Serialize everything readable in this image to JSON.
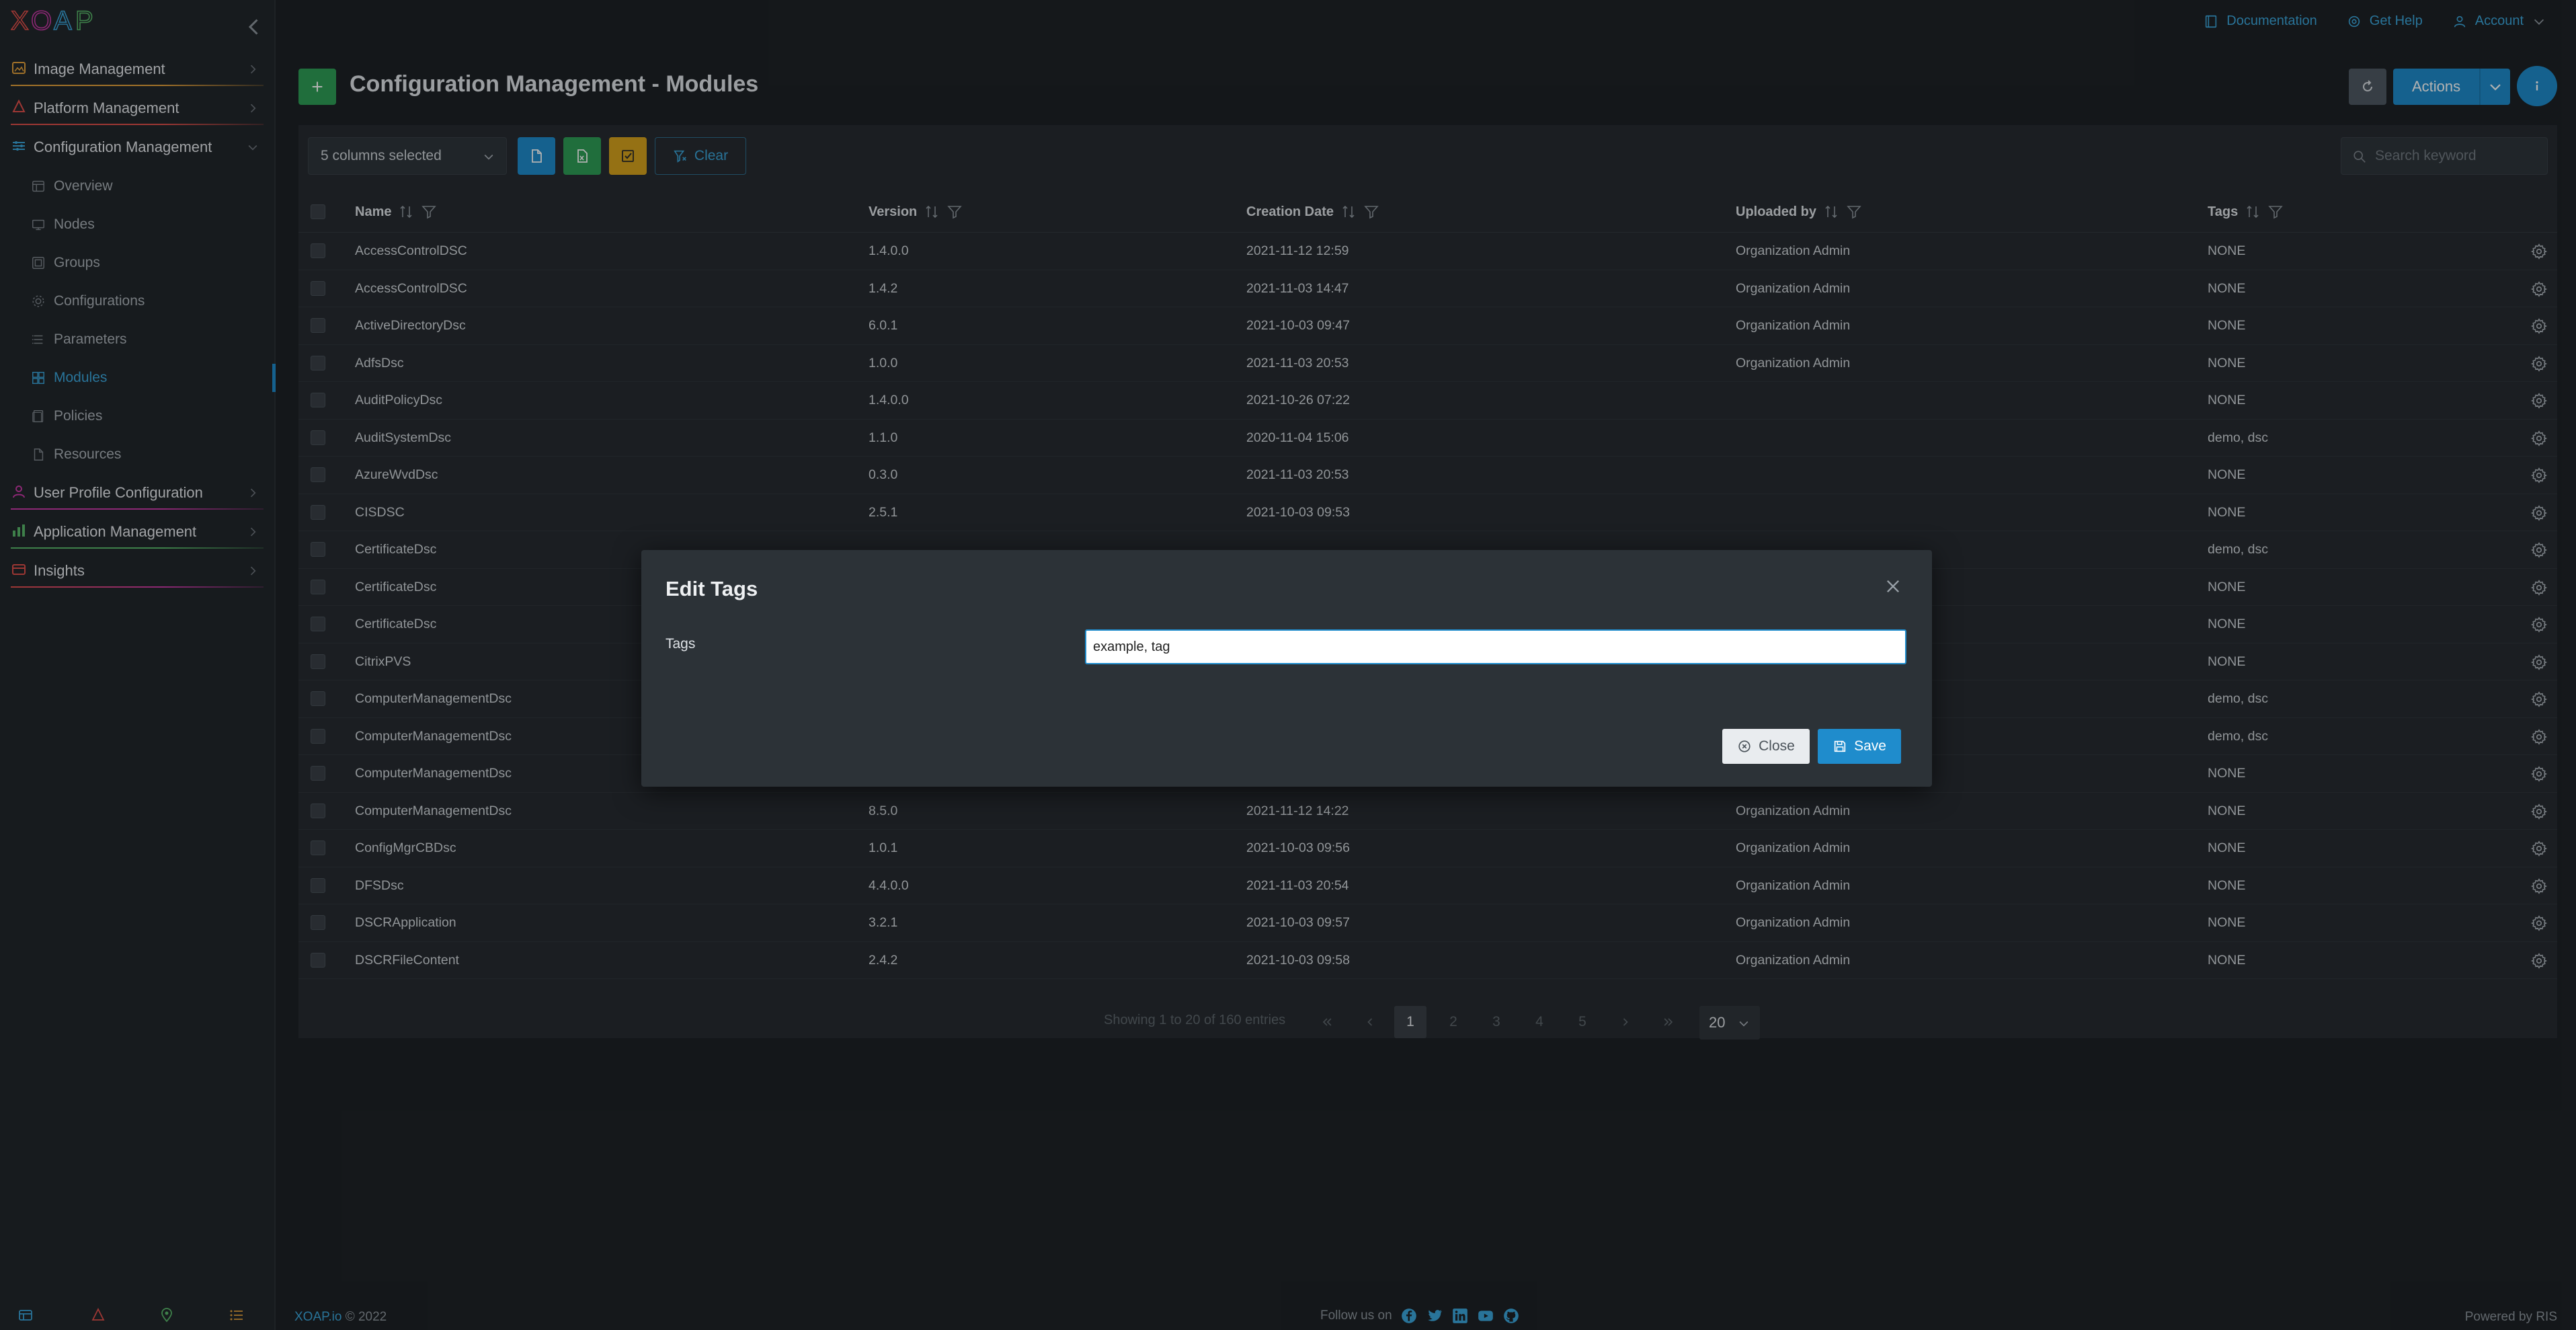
{
  "app": {
    "logo_text": "XOAP"
  },
  "colors": {
    "accent": "#1f8ccc",
    "add": "#2f9e57",
    "sidebar_bg": "#22272b",
    "panel_bg": "#272c31"
  },
  "sidebar": {
    "groups": [
      {
        "label": "Image Management",
        "icon": "image-icon",
        "color": "#e6a23c",
        "expanded": false
      },
      {
        "label": "Platform Management",
        "icon": "platform-icon",
        "color": "#e0504b",
        "expanded": false
      },
      {
        "label": "Configuration Management",
        "icon": "config-icon",
        "color": "#3ba6dc",
        "expanded": true
      },
      {
        "label": "User Profile Configuration",
        "icon": "user-profile-icon",
        "color": "#c93aa8",
        "expanded": false
      },
      {
        "label": "Application Management",
        "icon": "application-icon",
        "color": "#59b86a",
        "expanded": false
      },
      {
        "label": "Insights",
        "icon": "insights-icon",
        "color": "#e0504b",
        "expanded": false
      }
    ],
    "config_items": [
      {
        "label": "Overview",
        "icon": "overview-icon"
      },
      {
        "label": "Nodes",
        "icon": "nodes-icon"
      },
      {
        "label": "Groups",
        "icon": "groups-icon"
      },
      {
        "label": "Configurations",
        "icon": "configurations-icon"
      },
      {
        "label": "Parameters",
        "icon": "parameters-icon"
      },
      {
        "label": "Modules",
        "icon": "modules-icon",
        "active": true
      },
      {
        "label": "Policies",
        "icon": "policies-icon"
      },
      {
        "label": "Resources",
        "icon": "resources-icon"
      }
    ]
  },
  "topbar": {
    "documentation": "Documentation",
    "get_help": "Get Help",
    "account": "Account"
  },
  "header": {
    "add_label": "+",
    "title": "Configuration Management - Modules",
    "actions_label": "Actions"
  },
  "toolbar": {
    "columns_selected": "5 columns selected",
    "clear_label": "Clear",
    "search_placeholder": "Search keyword"
  },
  "table": {
    "columns": [
      "Name",
      "Version",
      "Creation Date",
      "Uploaded by",
      "Tags"
    ],
    "rows": [
      {
        "name": "AccessControlDSC",
        "version": "1.4.0.0",
        "date": "2021-11-12 12:59",
        "uploaded_by": "Organization Admin",
        "tags": "NONE"
      },
      {
        "name": "AccessControlDSC",
        "version": "1.4.2",
        "date": "2021-11-03 14:47",
        "uploaded_by": "Organization Admin",
        "tags": "NONE"
      },
      {
        "name": "ActiveDirectoryDsc",
        "version": "6.0.1",
        "date": "2021-10-03 09:47",
        "uploaded_by": "Organization Admin",
        "tags": "NONE"
      },
      {
        "name": "AdfsDsc",
        "version": "1.0.0",
        "date": "2021-11-03 20:53",
        "uploaded_by": "Organization Admin",
        "tags": "NONE"
      },
      {
        "name": "AuditPolicyDsc",
        "version": "1.4.0.0",
        "date": "2021-10-26 07:22",
        "uploaded_by": "",
        "tags": "NONE"
      },
      {
        "name": "AuditSystemDsc",
        "version": "1.1.0",
        "date": "2020-11-04 15:06",
        "uploaded_by": "",
        "tags": "demo, dsc"
      },
      {
        "name": "AzureWvdDsc",
        "version": "0.3.0",
        "date": "2021-11-03 20:53",
        "uploaded_by": "",
        "tags": "NONE"
      },
      {
        "name": "CISDSC",
        "version": "2.5.1",
        "date": "2021-10-03 09:53",
        "uploaded_by": "",
        "tags": "NONE"
      },
      {
        "name": "CertificateDsc",
        "version": "",
        "date": "",
        "uploaded_by": "",
        "tags": "demo, dsc"
      },
      {
        "name": "CertificateDsc",
        "version": "",
        "date": "",
        "uploaded_by": "",
        "tags": "NONE"
      },
      {
        "name": "CertificateDsc",
        "version": "",
        "date": "",
        "uploaded_by": "",
        "tags": "NONE"
      },
      {
        "name": "CitrixPVS",
        "version": "",
        "date": "",
        "uploaded_by": "",
        "tags": "NONE"
      },
      {
        "name": "ComputerManagementDsc",
        "version": "",
        "date": "",
        "uploaded_by": "",
        "tags": "demo, dsc"
      },
      {
        "name": "ComputerManagementDsc",
        "version": "",
        "date": "",
        "uploaded_by": "",
        "tags": "demo, dsc"
      },
      {
        "name": "ComputerManagementDsc",
        "version": "",
        "date": "",
        "uploaded_by": "",
        "tags": "NONE"
      },
      {
        "name": "ComputerManagementDsc",
        "version": "8.5.0",
        "date": "2021-11-12 14:22",
        "uploaded_by": "Organization Admin",
        "tags": "NONE"
      },
      {
        "name": "ConfigMgrCBDsc",
        "version": "1.0.1",
        "date": "2021-10-03 09:56",
        "uploaded_by": "Organization Admin",
        "tags": "NONE"
      },
      {
        "name": "DFSDsc",
        "version": "4.4.0.0",
        "date": "2021-11-03 20:54",
        "uploaded_by": "Organization Admin",
        "tags": "NONE"
      },
      {
        "name": "DSCRApplication",
        "version": "3.2.1",
        "date": "2021-10-03 09:57",
        "uploaded_by": "Organization Admin",
        "tags": "NONE"
      },
      {
        "name": "DSCRFileContent",
        "version": "2.4.2",
        "date": "2021-10-03 09:58",
        "uploaded_by": "Organization Admin",
        "tags": "NONE"
      }
    ]
  },
  "pagination": {
    "info": "Showing 1 to 20 of 160 entries",
    "pages": [
      "1",
      "2",
      "3",
      "4",
      "5"
    ],
    "current_page": "1",
    "page_size": "20"
  },
  "footer": {
    "brand": "XOAP.io",
    "copyright": "© 2022",
    "follow_us": "Follow us on",
    "powered_by": "Powered by RIS"
  },
  "modal": {
    "title": "Edit Tags",
    "tags_label": "Tags",
    "tags_value": "example, tag",
    "close_label": "Close",
    "save_label": "Save"
  }
}
